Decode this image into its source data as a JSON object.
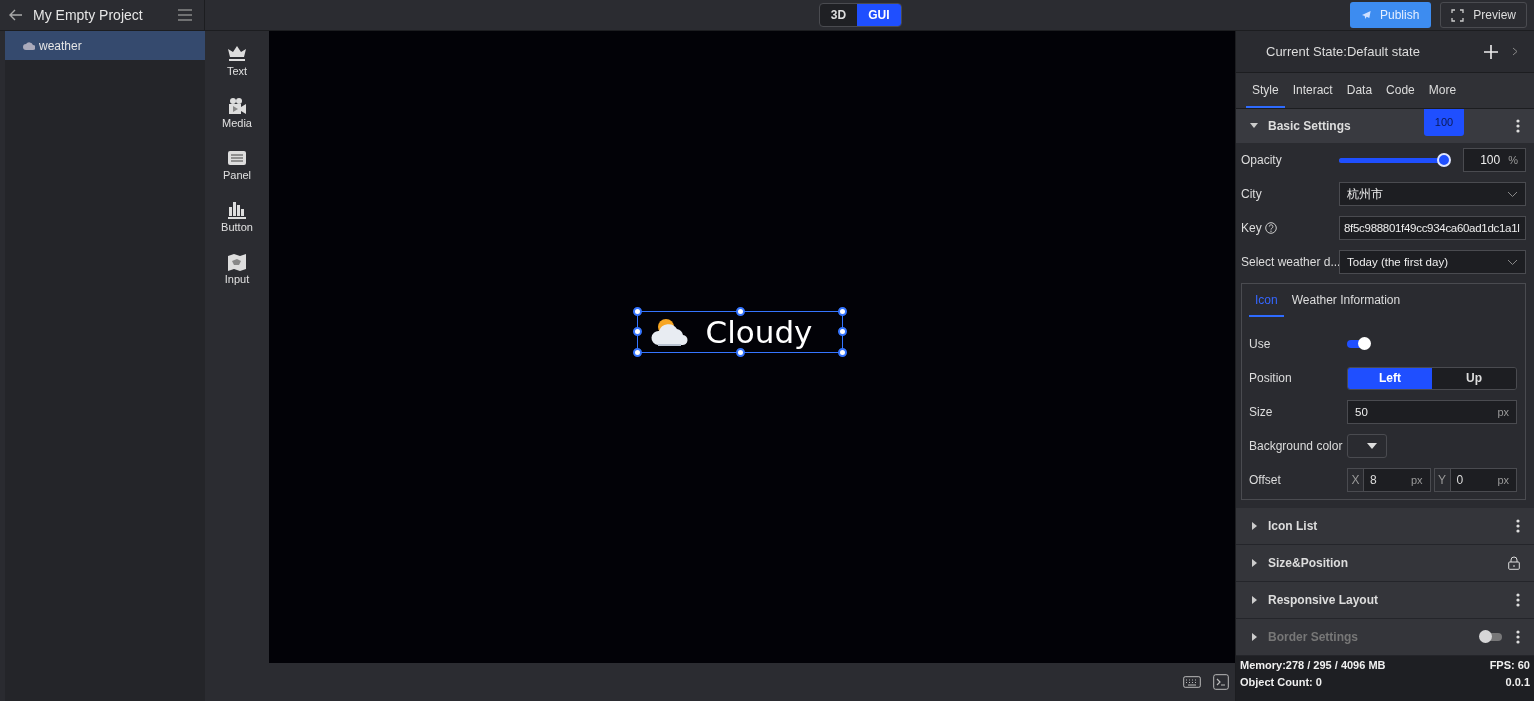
{
  "header": {
    "project_title": "My Empty Project",
    "view_modes": [
      {
        "label": "3D",
        "selected": false
      },
      {
        "label": "GUI",
        "selected": true
      }
    ],
    "buttons": [
      {
        "label": "Publish",
        "kind": "primary"
      },
      {
        "label": "Preview",
        "kind": "outline"
      }
    ]
  },
  "layers": [
    {
      "label": "weather",
      "selected": true
    }
  ],
  "components": [
    {
      "label": "Text",
      "kind": "text"
    },
    {
      "label": "Media",
      "kind": "media"
    },
    {
      "label": "Panel",
      "kind": "panel"
    },
    {
      "label": "Button",
      "kind": "button"
    },
    {
      "label": "Input",
      "kind": "input"
    }
  ],
  "canvas": {
    "widget": {
      "label": "Cloudy",
      "selected": true
    }
  },
  "inspector": {
    "current_state": "Current State:Default state",
    "tabs": [
      {
        "label": "Style",
        "selected": true
      },
      {
        "label": "Interact",
        "selected": false
      },
      {
        "label": "Data",
        "selected": false
      },
      {
        "label": "Code",
        "selected": false
      },
      {
        "label": "More",
        "selected": false
      }
    ],
    "sections": [
      {
        "title": "Basic Settings",
        "expanded": true,
        "disabled": false,
        "kind": "more",
        "fields": [
          {
            "kind": "slider",
            "label": "Opacity",
            "level": 1.0,
            "tooltip": "100",
            "value": "100",
            "unit": "%"
          },
          {
            "kind": "select",
            "label": "City",
            "value": "杭州市"
          },
          {
            "kind": "text",
            "label": "Key",
            "help": true,
            "value": "8f5c988801f49cc934ca60ad1dc1a1l"
          },
          {
            "kind": "select",
            "label": "Select weather d...",
            "value": "Today (the first day)"
          }
        ],
        "subpanel": {
          "tabs": [
            {
              "label": "Icon",
              "selected": true
            },
            {
              "label": "Weather Information",
              "selected": false
            }
          ],
          "fields": [
            {
              "kind": "toggle",
              "label": "Use",
              "on": true
            },
            {
              "kind": "segments",
              "label": "Position",
              "options": [
                {
                  "label": "Left",
                  "selected": true
                },
                {
                  "label": "Up",
                  "selected": false
                }
              ]
            },
            {
              "kind": "number",
              "label": "Size",
              "value": "50",
              "unit": "px"
            },
            {
              "kind": "color",
              "label": "Background color"
            },
            {
              "kind": "offset",
              "label": "Offset",
              "parts": [
                {
                  "axis": "X",
                  "value": "8",
                  "unit": "px"
                },
                {
                  "axis": "Y",
                  "value": "0",
                  "unit": "px"
                }
              ]
            }
          ]
        }
      },
      {
        "title": "Icon List",
        "expanded": false,
        "disabled": false,
        "kind": "more"
      },
      {
        "title": "Size&Position",
        "expanded": false,
        "disabled": false,
        "kind": "lock"
      },
      {
        "title": "Responsive Layout",
        "expanded": false,
        "disabled": false,
        "kind": "more"
      },
      {
        "title": "Border Settings",
        "expanded": false,
        "disabled": true,
        "kind": "toggle",
        "on": false
      }
    ]
  },
  "status_bar": {
    "memory": "Memory:278 / 295 / 4096 MB",
    "fps": "FPS: 60",
    "object_count": "Object Count: 0",
    "version": "0.0.1"
  }
}
